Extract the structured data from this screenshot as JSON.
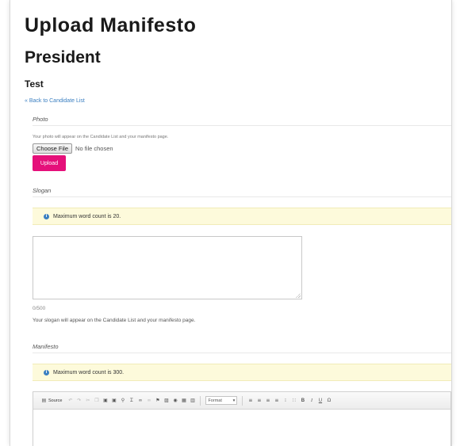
{
  "page": {
    "title": "Upload Manifesto",
    "position": "President",
    "candidate": "Test",
    "back_link": "« Back to Candidate List"
  },
  "photo": {
    "label": "Photo",
    "help": "Your photo will appear on the Candidate List and your manifesto page.",
    "choose_file_label": "Choose File",
    "file_status": "No file chosen",
    "upload_label": "Upload"
  },
  "slogan": {
    "label": "Slogan",
    "notice": "Maximum word count is 20.",
    "value": "",
    "char_count": "0/500",
    "help": "Your slogan will appear on the Candidate List and your manifesto page."
  },
  "manifesto": {
    "label": "Manifesto",
    "notice": "Maximum word count is 300.",
    "toolbar": {
      "source_label": "Source",
      "format_label": "Format",
      "bold_glyph": "B",
      "italic_glyph": "I",
      "underline_glyph": "U",
      "omega_glyph": "Ω"
    }
  },
  "colors": {
    "accent": "#e5107a",
    "link": "#3a7fc1",
    "notice_bg": "#fdfadb"
  }
}
